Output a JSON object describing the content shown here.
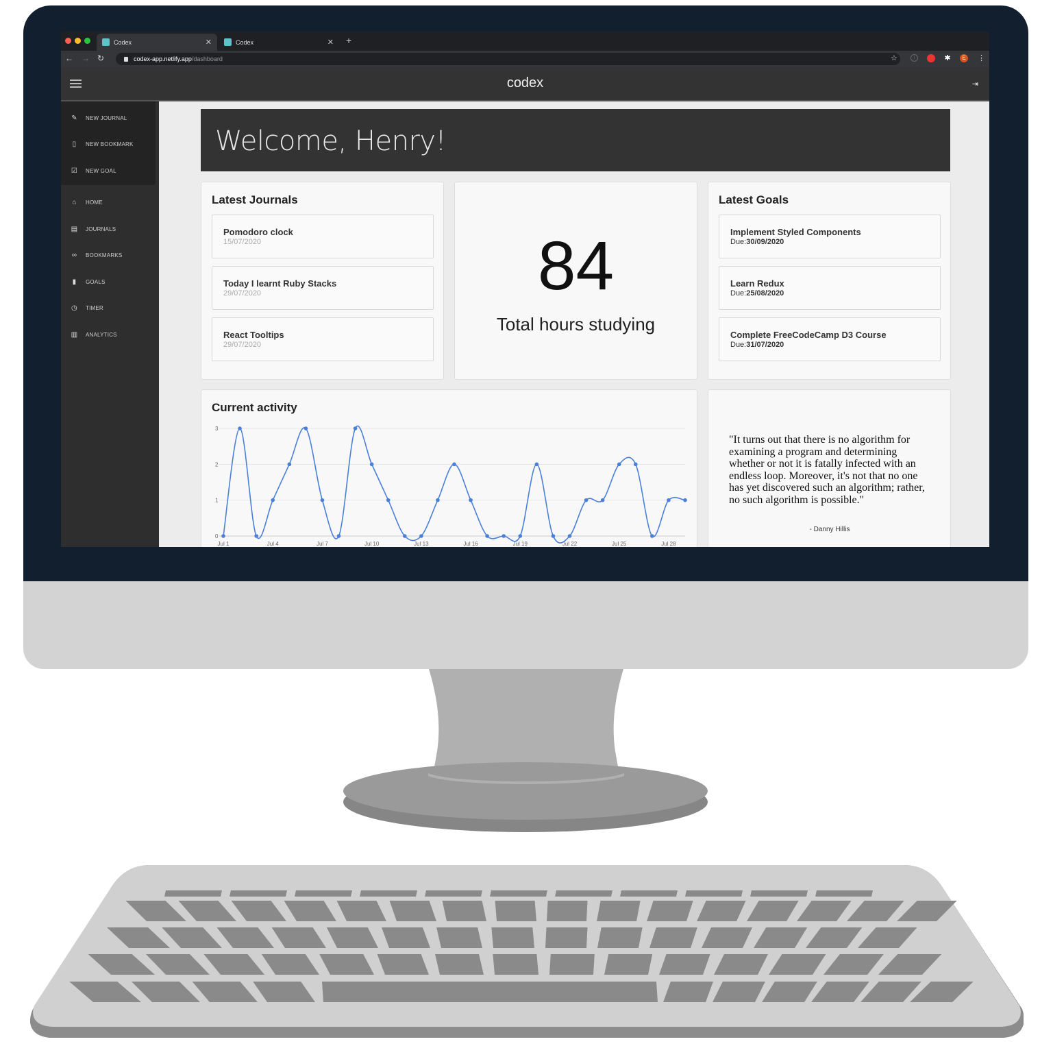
{
  "browser": {
    "tabs": [
      {
        "title": "Codex",
        "active": true
      },
      {
        "title": "Codex",
        "active": false
      }
    ],
    "url_host": "codex-app.netlify.app",
    "url_path": "/dashboard",
    "profile_initial": "E"
  },
  "app": {
    "title": "codex"
  },
  "sidebar": {
    "actions": [
      {
        "label": "NEW JOURNAL",
        "icon": "edit-icon"
      },
      {
        "label": "NEW BOOKMARK",
        "icon": "bookmark-icon"
      },
      {
        "label": "NEW GOAL",
        "icon": "calendar-check-icon"
      }
    ],
    "nav": [
      {
        "label": "HOME",
        "icon": "home-icon"
      },
      {
        "label": "JOURNALS",
        "icon": "book-icon"
      },
      {
        "label": "BOOKMARKS",
        "icon": "link-icon"
      },
      {
        "label": "GOALS",
        "icon": "clipboard-icon"
      },
      {
        "label": "TIMER",
        "icon": "clock-icon"
      },
      {
        "label": "ANALYTICS",
        "icon": "chart-icon"
      }
    ]
  },
  "welcome": {
    "text": "Welcome, Henry!"
  },
  "journals": {
    "title": "Latest Journals",
    "items": [
      {
        "title": "Pomodoro clock",
        "date": "15/07/2020"
      },
      {
        "title": "Today I learnt Ruby Stacks",
        "date": "29/07/2020"
      },
      {
        "title": "React Tooltips",
        "date": "29/07/2020"
      }
    ]
  },
  "hours": {
    "value": "84",
    "caption": "Total hours studying"
  },
  "goals": {
    "title": "Latest Goals",
    "due_label": "Due:",
    "items": [
      {
        "title": "Implement Styled Components",
        "due": "30/09/2020"
      },
      {
        "title": "Learn Redux",
        "due": "25/08/2020"
      },
      {
        "title": "Complete FreeCodeCamp D3 Course",
        "due": "31/07/2020"
      }
    ]
  },
  "activity": {
    "title": "Current activity"
  },
  "quote": {
    "text": "\"It turns out that there is no algorithm for examining a program and determining whether or not it is fatally infected with an endless loop. Moreover, it's not that no one has yet discovered such an algorithm; rather, no such algorithm is possible.\"",
    "author": "- Danny Hillis"
  },
  "chart_data": {
    "type": "line",
    "title": "Current activity",
    "x": [
      "Jul 1",
      "Jul 2",
      "Jul 3",
      "Jul 4",
      "Jul 5",
      "Jul 6",
      "Jul 7",
      "Jul 8",
      "Jul 9",
      "Jul 10",
      "Jul 11",
      "Jul 12",
      "Jul 13",
      "Jul 14",
      "Jul 15",
      "Jul 16",
      "Jul 17",
      "Jul 18",
      "Jul 19",
      "Jul 20",
      "Jul 21",
      "Jul 22",
      "Jul 23",
      "Jul 24",
      "Jul 25",
      "Jul 26",
      "Jul 27",
      "Jul 28",
      "Jul 29"
    ],
    "x_tick_labels": [
      "Jul 1",
      "Jul 4",
      "Jul 7",
      "Jul 10",
      "Jul 13",
      "Jul 16",
      "Jul 19",
      "Jul 22",
      "Jul 25",
      "Jul 28"
    ],
    "values": [
      0,
      3,
      0,
      1,
      2,
      3,
      1,
      0,
      3,
      2,
      1,
      0,
      0,
      1,
      2,
      1,
      0,
      0,
      0,
      2,
      0,
      0,
      1,
      1,
      2,
      2,
      0,
      1,
      1
    ],
    "ylim": [
      0,
      3
    ],
    "y_ticks": [
      0,
      1,
      2,
      3
    ],
    "grid": true,
    "color": "#4a7fd8"
  }
}
